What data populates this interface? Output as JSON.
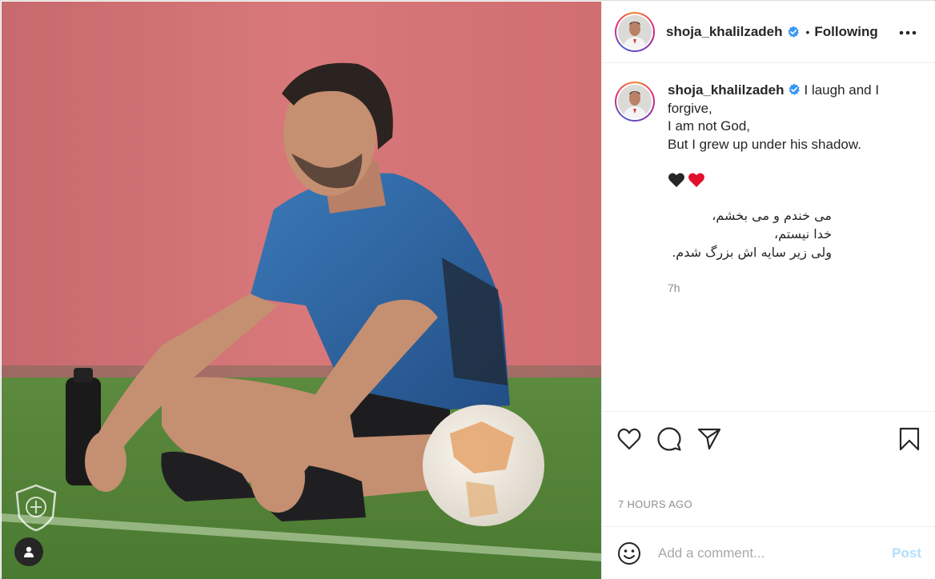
{
  "post": {
    "username": "shoja_khalilzadeh",
    "separator": "•",
    "follow_status": "Following",
    "caption_first_line": "I laugh and I forgive,",
    "caption_lines": [
      "I am not God,",
      "But I grew up under his shadow."
    ],
    "hearts": "🖤❤️",
    "persian_lines": [
      "می خندم و می بخشم،",
      "خدا نیستم،",
      "ولی زیر سایه اش بزرگ شدم."
    ],
    "caption_age": "7h",
    "timestamp": "7 HOURS AGO"
  },
  "comment": {
    "placeholder": "Add a comment...",
    "post_label": "Post"
  },
  "icons": {
    "verified": "verified-badge-icon",
    "more": "more-options-icon",
    "like": "heart-icon",
    "comment": "comment-icon",
    "share": "share-icon",
    "save": "bookmark-icon",
    "emoji": "emoji-icon",
    "user_tag": "user-tag-icon"
  },
  "colors": {
    "verified": "#3897f0",
    "post_disabled": "#b2dffc",
    "muted": "#8e8e8e",
    "text": "#262626"
  }
}
